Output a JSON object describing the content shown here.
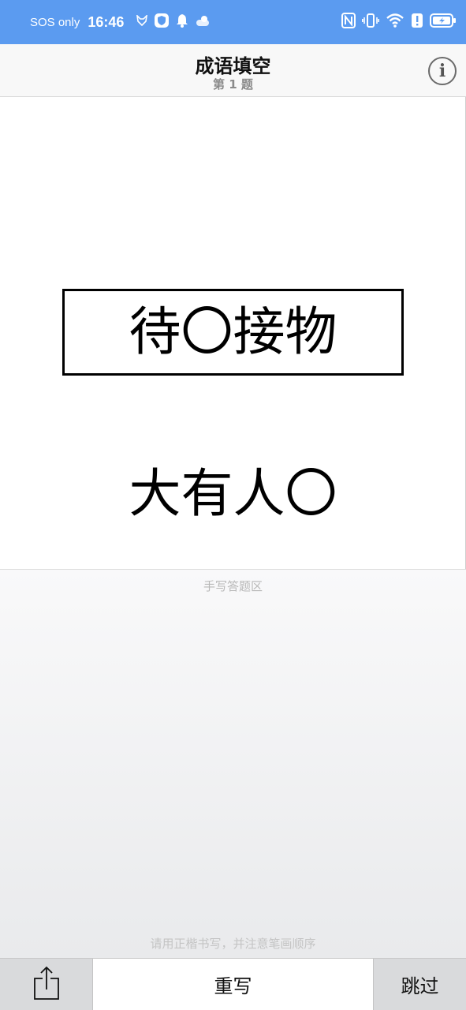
{
  "status_bar": {
    "network_text": "SOS only",
    "time": "16:46",
    "left_icons": [
      "fox-icon",
      "shield-icon",
      "bell-icon",
      "weather-icon"
    ],
    "right_icons": [
      "nfc-icon",
      "vibrate-icon",
      "wifi-icon",
      "alert-icon",
      "battery-icon"
    ]
  },
  "nav": {
    "title": "成语填空",
    "subtitle": "第 1 题",
    "info_glyph": "i"
  },
  "question": {
    "idioms": [
      {
        "text": "待〇接物",
        "highlighted": true
      },
      {
        "text": "大有人〇",
        "highlighted": false
      }
    ]
  },
  "handwriting": {
    "label": "手写答题区",
    "hint": "请用正楷书写，并注意笔画顺序"
  },
  "toolbar": {
    "share_icon": "share-icon",
    "rewrite_label": "重写",
    "skip_label": "跳过"
  },
  "colors": {
    "status_bar_bg": "#5b9bf0",
    "nav_bg": "#f8f8f8",
    "toolbar_side_bg": "#d9dadc"
  }
}
